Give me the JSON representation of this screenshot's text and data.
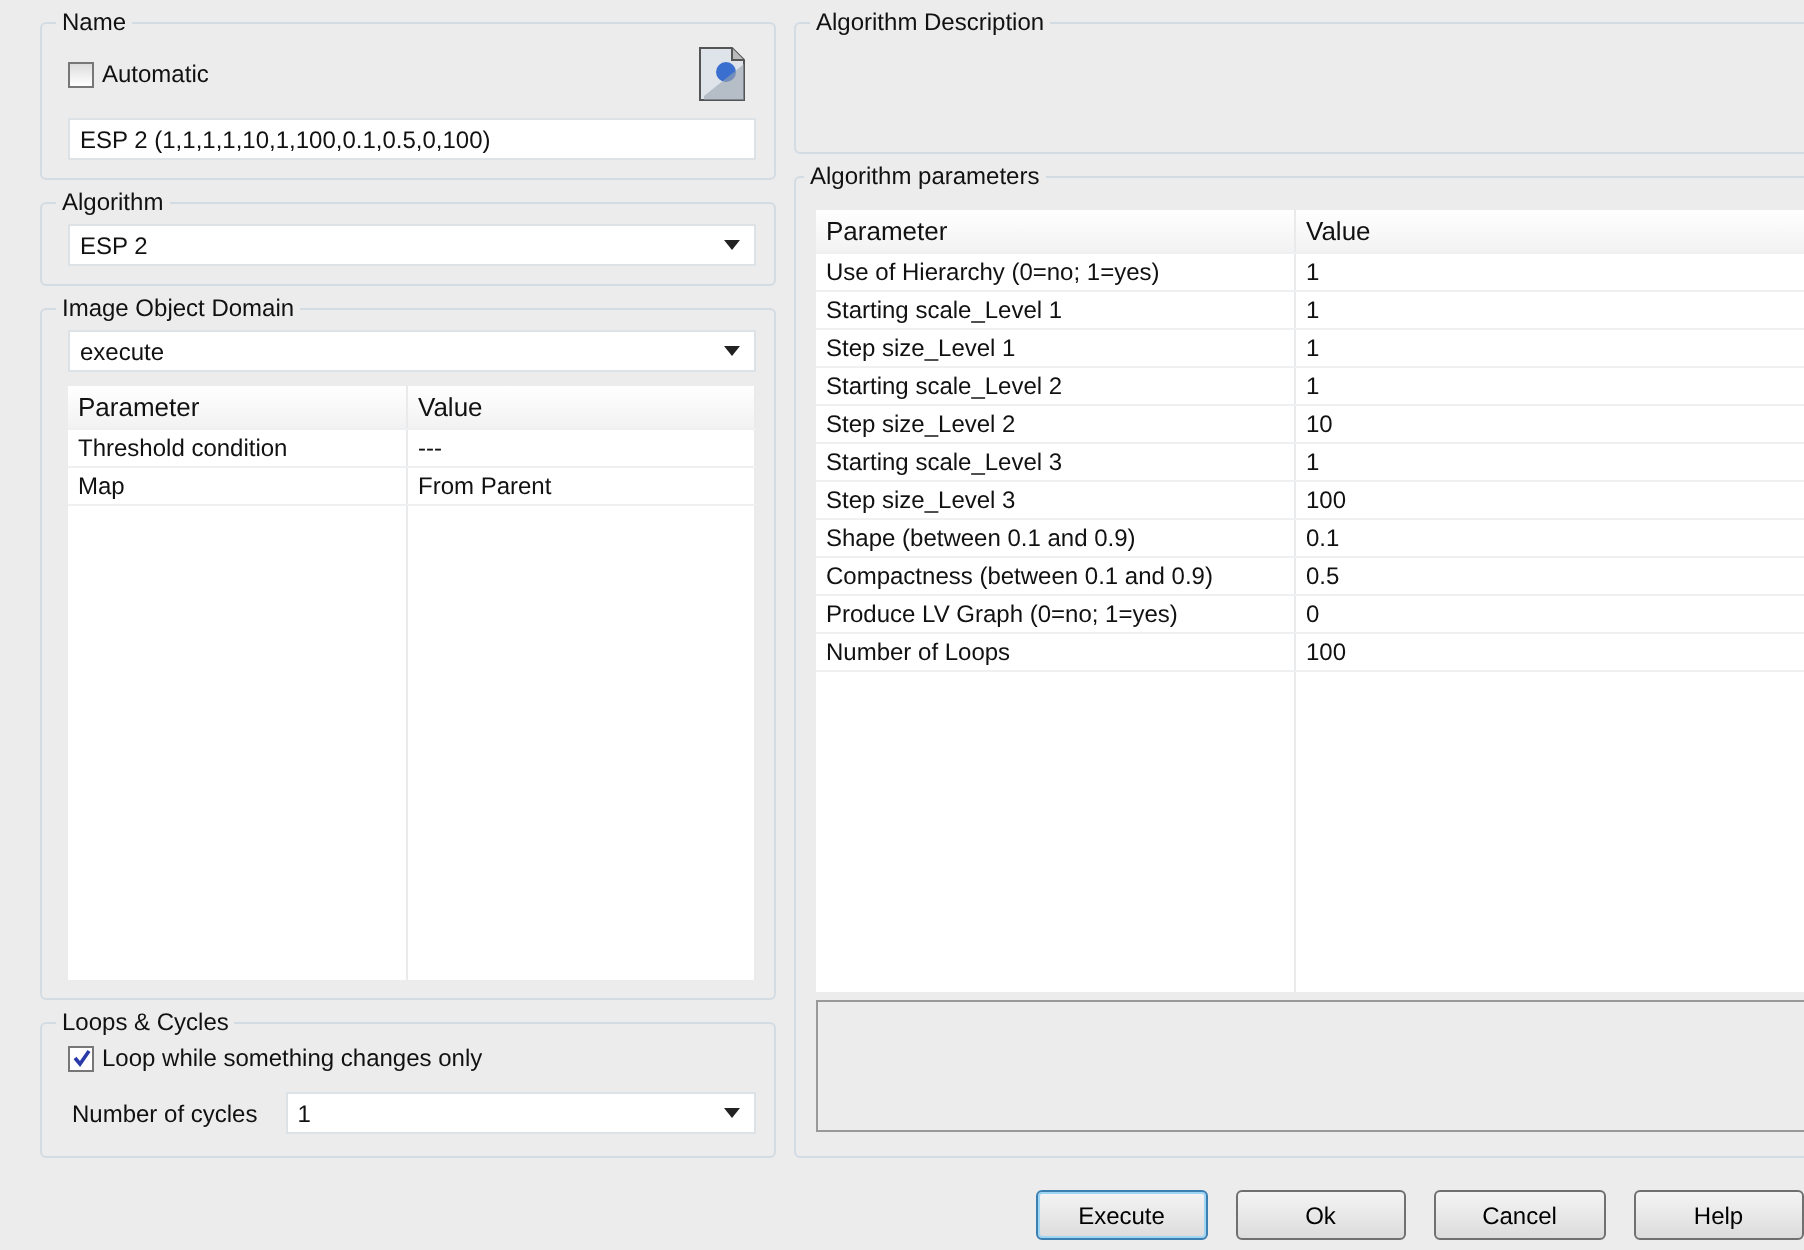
{
  "name_group": {
    "title": "Name",
    "automatic": {
      "label": "Automatic",
      "checked": false
    },
    "value": "ESP 2 (1,1,1,1,10,1,100,0.1,0.5,0,100)"
  },
  "algorithm_group": {
    "title": "Algorithm",
    "value": "ESP 2"
  },
  "domain_group": {
    "title": "Image Object Domain",
    "value": "execute",
    "table": {
      "columns": [
        "Parameter",
        "Value"
      ],
      "rows": [
        [
          "Threshold condition",
          "---"
        ],
        [
          "Map",
          "From Parent"
        ]
      ]
    }
  },
  "loops_group": {
    "title": "Loops & Cycles",
    "loop_option": {
      "label": "Loop while something changes only",
      "checked": true
    },
    "cycles_label": "Number of cycles",
    "cycles_value": "1"
  },
  "description_group": {
    "title": "Algorithm Description"
  },
  "parameters_group": {
    "title": "Algorithm parameters",
    "table": {
      "columns": [
        "Parameter",
        "Value"
      ],
      "rows": [
        [
          "Use of Hierarchy (0=no; 1=yes)",
          "1"
        ],
        [
          "Starting scale_Level 1",
          "1"
        ],
        [
          "Step size_Level 1",
          "1"
        ],
        [
          "Starting scale_Level 2",
          "1"
        ],
        [
          "Step size_Level 2",
          "10"
        ],
        [
          "Starting scale_Level 3",
          "1"
        ],
        [
          "Step size_Level 3",
          "100"
        ],
        [
          "Shape (between 0.1 and 0.9)",
          "0.1"
        ],
        [
          "Compactness (between 0.1 and 0.9)",
          "0.5"
        ],
        [
          "Produce LV Graph (0=no; 1=yes)",
          "0"
        ],
        [
          "Number of Loops",
          "100"
        ]
      ]
    }
  },
  "buttons": [
    {
      "label": "Execute",
      "default": true
    },
    {
      "label": "Ok",
      "default": false
    },
    {
      "label": "Cancel",
      "default": false
    },
    {
      "label": "Help",
      "default": false
    }
  ]
}
